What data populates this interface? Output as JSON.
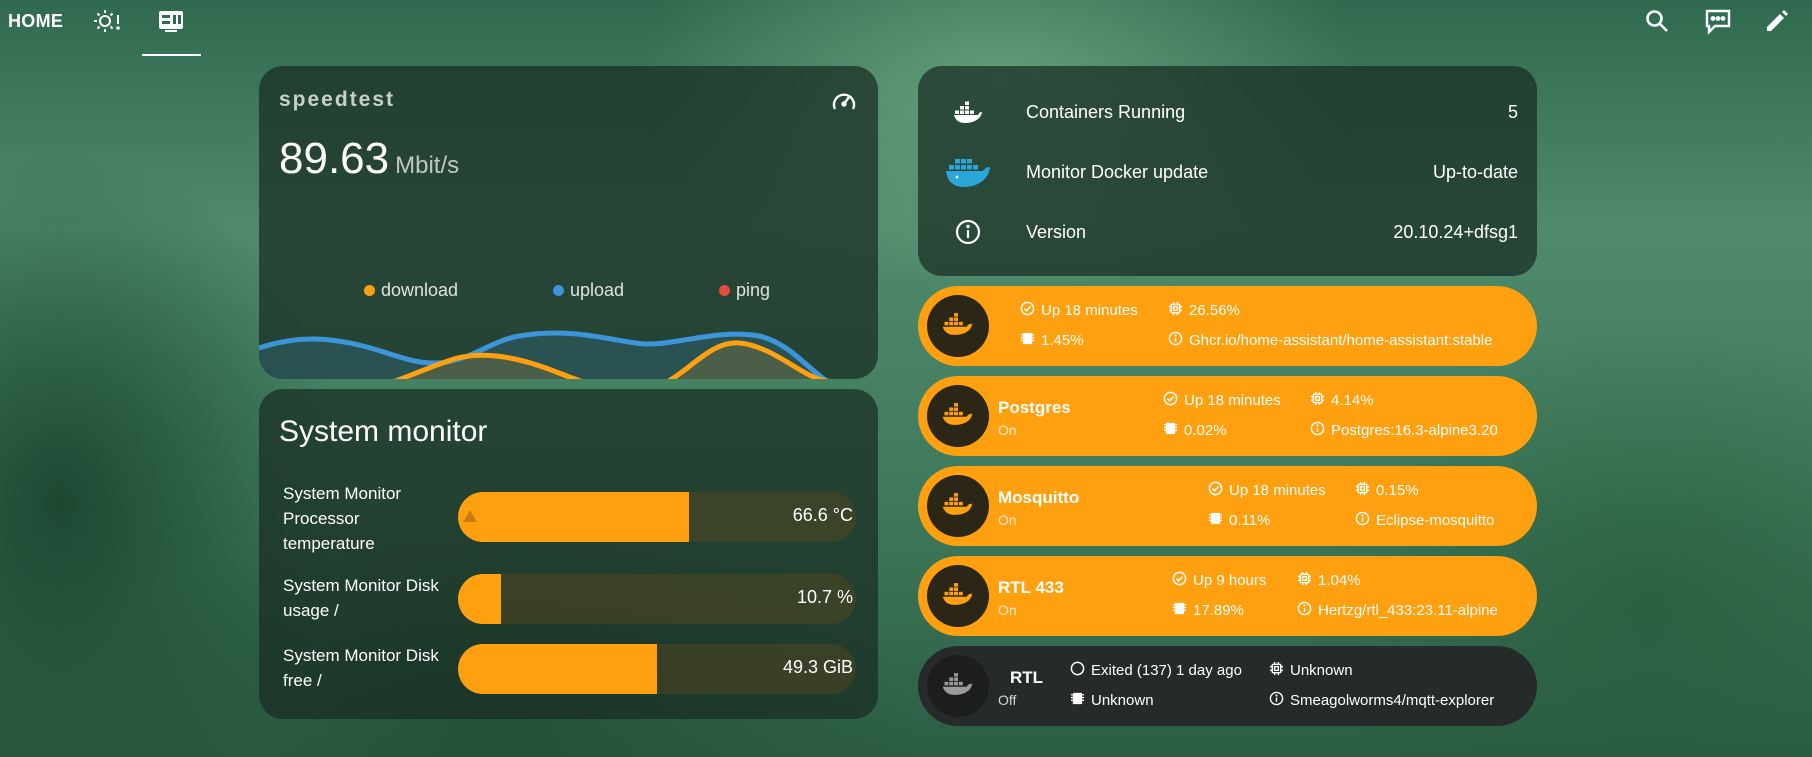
{
  "tabs": {
    "home_label": "HOME",
    "tab2_icon": "weather-sun-alert-icon",
    "tab3_icon": "server-network-icon",
    "active_tab": 2
  },
  "actions": {
    "search_icon": "search-icon",
    "assist_icon": "chat-icon",
    "edit_icon": "pencil-icon"
  },
  "speedtest": {
    "name": "speedtest",
    "value": "89.63",
    "unit": "Mbit/s",
    "icon": "speedometer-icon",
    "legend": [
      {
        "label": "download",
        "color": "#fea010"
      },
      {
        "label": "upload",
        "color": "#3c95d8"
      },
      {
        "label": "ping",
        "color": "#e44b3c"
      }
    ]
  },
  "system_monitor": {
    "title": "System monitor",
    "items": [
      {
        "label": "System Monitor Processor temperature",
        "value": "66.6 °C",
        "fill": 0.58,
        "warning": true
      },
      {
        "label": "System Monitor Disk usage /",
        "value": "10.7 %",
        "fill": 0.107,
        "warning": false
      },
      {
        "label": "System Monitor Disk free /",
        "value": "49.3 GiB",
        "fill": 0.5,
        "warning": false
      }
    ]
  },
  "docker_info": {
    "rows": [
      {
        "icon": "docker-icon",
        "label": "Containers Running",
        "value": "5"
      },
      {
        "icon": "docker-whale-logo-icon",
        "label": "Monitor Docker update",
        "value": "Up-to-date"
      },
      {
        "icon": "info-icon",
        "label": "Version",
        "value": "20.10.24+dfsg1"
      }
    ]
  },
  "containers": [
    {
      "name": "",
      "state": "",
      "status": "Up 18 minutes",
      "cpu": "26.56%",
      "memory": "1.45%",
      "image": "Ghcr.io/home-assistant/home-assistant:stable",
      "running": true
    },
    {
      "name": "Postgres",
      "state": "On",
      "status": "Up 18 minutes",
      "cpu": "4.14%",
      "memory": "0.02%",
      "image": "Postgres:16.3-alpine3.20",
      "running": true
    },
    {
      "name": "Mosquitto",
      "state": "On",
      "status": "Up 18 minutes",
      "cpu": "0.15%",
      "memory": "0.11%",
      "image": "Eclipse-mosquitto",
      "running": true
    },
    {
      "name": "RTL 433",
      "state": "On",
      "status": "Up 9 hours",
      "cpu": "1.04%",
      "memory": "17.89%",
      "image": "Hertzg/rtl_433:23.11-alpine",
      "running": true
    },
    {
      "name": "RTL",
      "state": "Off",
      "status": "Exited (137) 1 day ago",
      "cpu": "Unknown",
      "memory": "Unknown",
      "image": "Smeagolworms4/mqtt-explorer",
      "running": false
    }
  ]
}
